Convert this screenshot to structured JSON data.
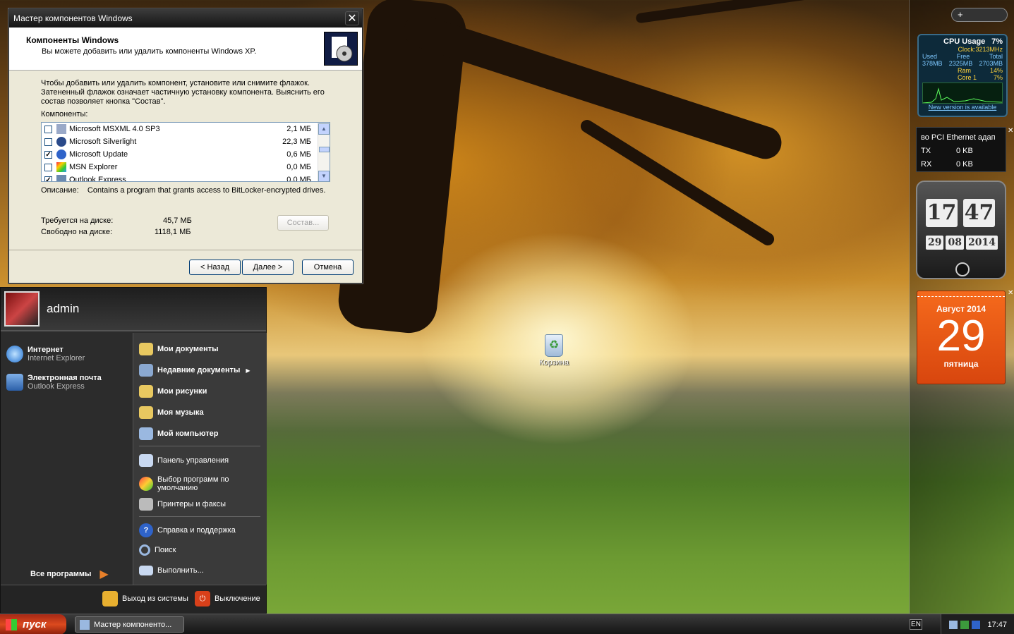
{
  "dialog": {
    "title": "Мастер компонентов Windows",
    "header_title": "Компоненты Windows",
    "header_subtitle": "Вы можете добавить или удалить компоненты Windows XP.",
    "instructions": "Чтобы добавить или удалить компонент, установите или снимите флажок. Затененный флажок означает частичную установку компонента. Выяснить его состав позволяет кнопка \"Состав\".",
    "components_label": "Компоненты:",
    "components": [
      {
        "name": "Microsoft MSXML 4.0 SP3",
        "size": "2,1 МБ",
        "checked": false
      },
      {
        "name": "Microsoft Silverlight",
        "size": "22,3 МБ",
        "checked": false
      },
      {
        "name": "Microsoft Update",
        "size": "0,6 МБ",
        "checked": true
      },
      {
        "name": "MSN Explorer",
        "size": "0,0 МБ",
        "checked": false
      },
      {
        "name": "Outlook Express",
        "size": "0,0 МБ",
        "checked": true
      }
    ],
    "description_label": "Описание:",
    "description": "Contains a program that grants access to BitLocker-encrypted drives.",
    "required_label": "Требуется на диске:",
    "required_value": "45,7 МБ",
    "free_label": "Свободно на диске:",
    "free_value": "1118,1 МБ",
    "details_button": "Состав...",
    "back_button": "< Назад",
    "next_button": "Далее >",
    "cancel_button": "Отмена"
  },
  "start_menu": {
    "user": "admin",
    "pinned": [
      {
        "title": "Интернет",
        "sub": "Internet Explorer"
      },
      {
        "title": "Электронная почта",
        "sub": "Outlook Express"
      }
    ],
    "all_programs": "Все программы",
    "right_bold": [
      "Мои документы",
      "Недавние документы",
      "Мои рисунки",
      "Моя музыка",
      "Мой компьютер"
    ],
    "right_items": [
      "Панель управления",
      "Выбор программ по умолчанию",
      "Принтеры и факсы",
      "Справка и поддержка",
      "Поиск",
      "Выполнить..."
    ],
    "logoff": "Выход из системы",
    "shutdown": "Выключение"
  },
  "desktop": {
    "recycle_bin": "Корзина"
  },
  "taskbar": {
    "start": "пуск",
    "task": "Мастер компоненто...",
    "lang": "EN",
    "clock": "17:47"
  },
  "gadgets": {
    "cpu_title": "CPU Usage",
    "cpu_pct": "7%",
    "clock_label": "Clock:",
    "clock_val": "3213MHz",
    "used_label": "Used",
    "free_label": "Free",
    "total_label": "Total",
    "used": "378MB",
    "free": "2325MB",
    "total": "2703MB",
    "ram_label": "Ram",
    "ram": "14%",
    "core_label": "Core 1",
    "core": "7%",
    "new_version": "New version is available",
    "net_title": "во PCI Ethernet адап",
    "tx_label": "TX",
    "tx": "0 KB",
    "rx_label": "RX",
    "rx": "0 KB",
    "flip_h": "17",
    "flip_m": "47",
    "flip_d": "29",
    "flip_mo": "08",
    "flip_y": "2014",
    "cal_month": "Август 2014",
    "cal_day": "29",
    "cal_weekday": "пятница"
  },
  "colors": {
    "accent": "#e85a12",
    "title": "#222222"
  }
}
